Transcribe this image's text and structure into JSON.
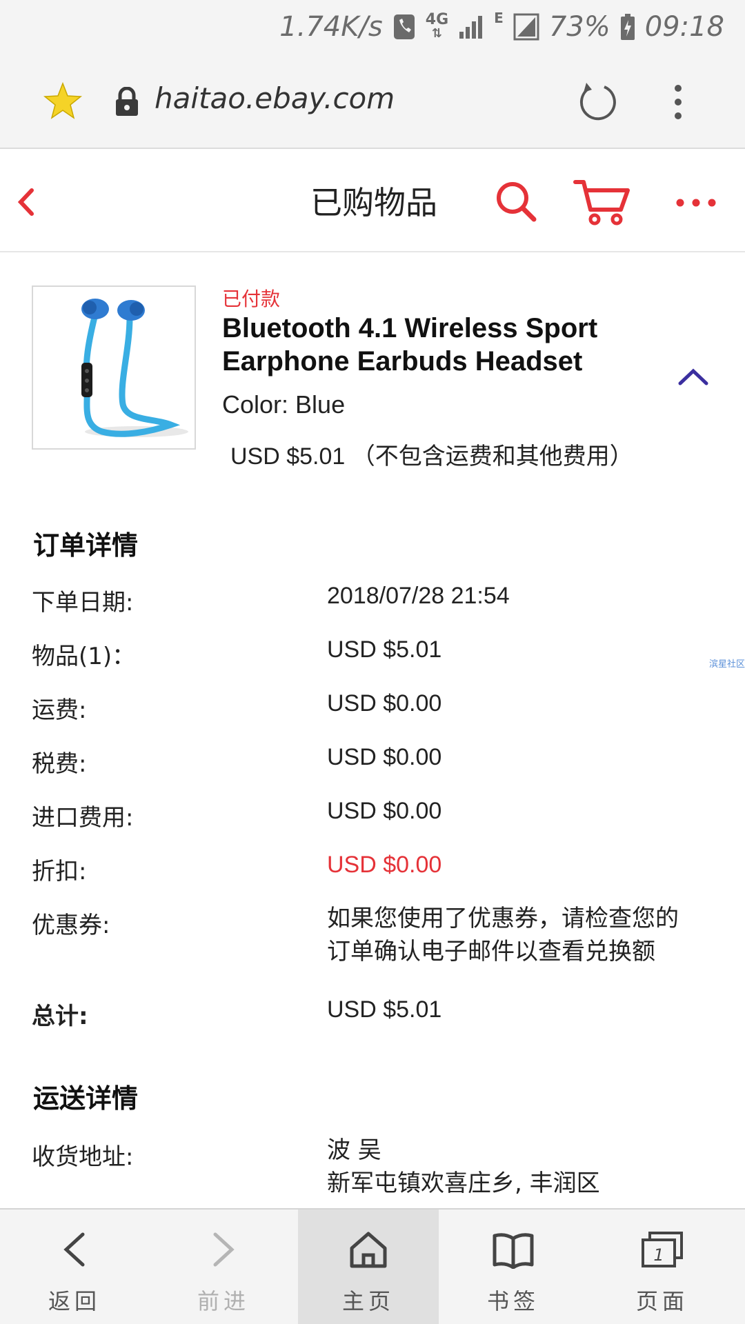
{
  "status_bar": {
    "speed": "1.74K/s",
    "network": "4G",
    "signal_extra": "E",
    "battery": "73%",
    "time": "09:18"
  },
  "browser": {
    "url": "haitao.ebay.com",
    "icons": [
      "star-icon",
      "lock-icon",
      "reload-icon",
      "kebab-icon"
    ]
  },
  "header": {
    "title": "已购物品",
    "accent": "#e53238"
  },
  "item": {
    "status": "已付款",
    "title": "Bluetooth 4.1 Wireless Sport Earphone Earbuds Headset",
    "color": "Color: Blue",
    "price": "USD $5.01 （不包含运费和其他费用）"
  },
  "order": {
    "title": "订单详情",
    "rows": [
      {
        "label": "下单日期:",
        "value": "2018/07/28 21:54"
      },
      {
        "label": "物品(1)：",
        "value": "USD $5.01"
      },
      {
        "label": "运费:",
        "value": "USD $0.00"
      },
      {
        "label": "税费:",
        "value": "USD $0.00"
      },
      {
        "label": "进口费用:",
        "value": "USD $0.00"
      },
      {
        "label": "折扣:",
        "value": "USD $0.00"
      },
      {
        "label": "优惠券:",
        "value": "如果您使用了优惠券，请检查您的订单确认电子邮件以查看兑换额"
      },
      {
        "label": "总计:",
        "value": "USD $5.01"
      }
    ]
  },
  "shipping": {
    "title": "运送详情",
    "address_label": "收货地址:",
    "address_name": "波 吴",
    "address_line": "新军屯镇欢喜庄乡, 丰润区"
  },
  "watermark": "滨星社区",
  "bottom_nav": {
    "back": "返回",
    "forward": "前进",
    "home": "主页",
    "bookmarks": "书签",
    "pages": "页面"
  }
}
